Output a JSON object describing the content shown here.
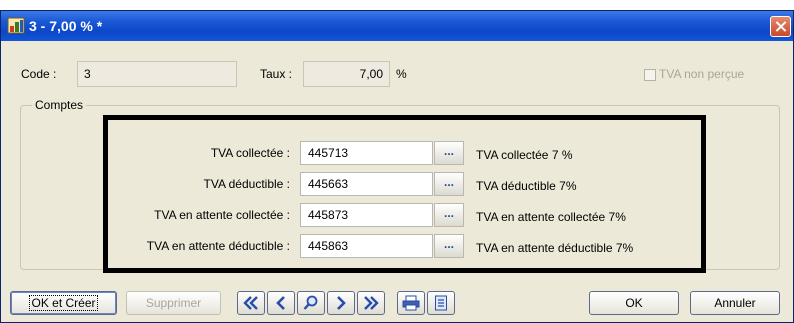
{
  "window": {
    "title": "3 - 7,00 % *"
  },
  "fields": {
    "code_label": "Code :",
    "code_value": "3",
    "taux_label": "Taux :",
    "taux_value": "7,00",
    "taux_unit": "%",
    "tva_non_percue_label": "TVA non perçue",
    "tva_non_percue_checked": false
  },
  "comptes": {
    "group_label": "Comptes",
    "rows": [
      {
        "label": "TVA collectée :",
        "account": "445713",
        "button": "...",
        "description": "TVA collectée 7 %"
      },
      {
        "label": "TVA déductible :",
        "account": "445663",
        "button": "...",
        "description": "TVA déductible 7%"
      },
      {
        "label": "TVA en attente collectée :",
        "account": "445873",
        "button": "...",
        "description": "TVA en attente collectée 7%"
      },
      {
        "label": "TVA en attente déductible :",
        "account": "445863",
        "button": "...",
        "description": "TVA en attente déductible 7%"
      }
    ]
  },
  "footer": {
    "ok_creer": "OK et Créer",
    "supprimer": "Supprimer",
    "nav_icons": [
      "first-icon",
      "previous-icon",
      "search-icon",
      "next-icon",
      "last-icon"
    ],
    "print_icon": "printer-icon",
    "preview_icon": "print-preview-icon",
    "ok": "OK",
    "annuler": "Annuler"
  },
  "colors": {
    "titlebar": "#0a47c9",
    "window_bg": "#ece9d8",
    "nav_icon": "#274ea8",
    "highlight_frame": "#000000"
  }
}
